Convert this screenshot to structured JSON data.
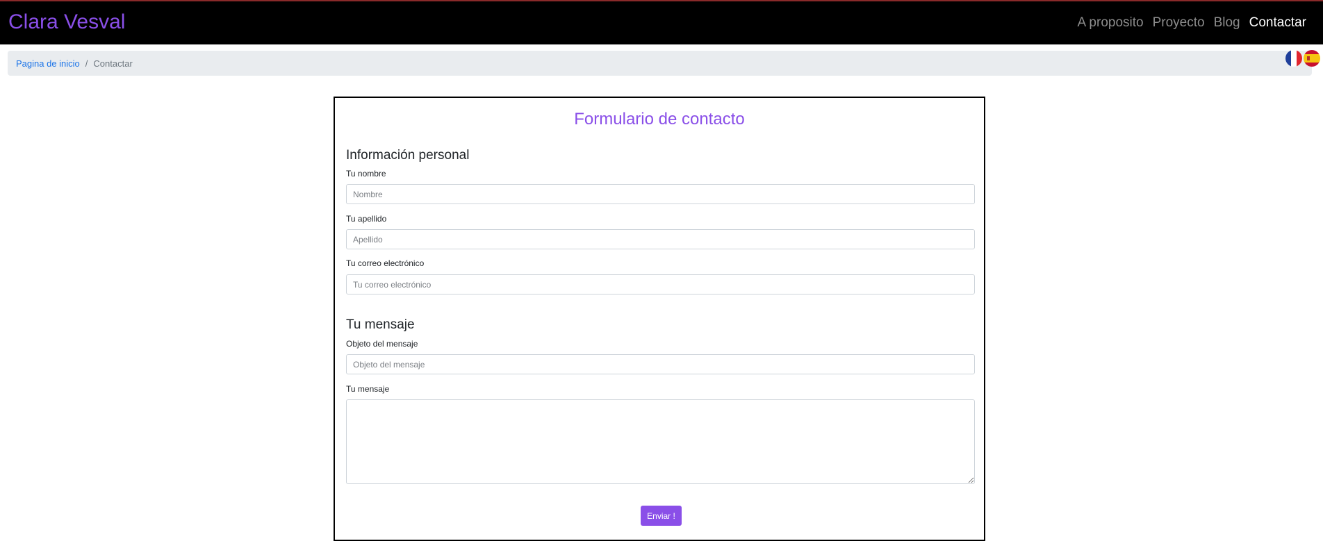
{
  "navbar": {
    "brand": "Clara Vesval",
    "links": [
      {
        "label": "A proposito",
        "active": false
      },
      {
        "label": "Proyecto",
        "active": false
      },
      {
        "label": "Blog",
        "active": false
      },
      {
        "label": "Contactar",
        "active": true
      }
    ]
  },
  "breadcrumb": {
    "home": "Pagina de inicio",
    "separator": "/",
    "current": "Contactar"
  },
  "language_flags": [
    "french-flag-icon",
    "spanish-flag-icon"
  ],
  "form": {
    "title": "Formulario de contacto",
    "personal_section": "Información personal",
    "name_label": "Tu nombre",
    "name_placeholder": "Nombre",
    "surname_label": "Tu apellido",
    "surname_placeholder": "Apellido",
    "email_label": "Tu correo electrónico",
    "email_placeholder": "Tu correo electrónico",
    "message_section": "Tu mensaje",
    "subject_label": "Objeto del mensaje",
    "subject_placeholder": "Objeto del mensaje",
    "message_label": "Tu mensaje",
    "submit_label": "Enviar !"
  },
  "colors": {
    "accent": "#8a4fe8",
    "navbar_bg": "#000000",
    "breadcrumb_bg": "#e9ecef",
    "link": "#1a73e8"
  }
}
